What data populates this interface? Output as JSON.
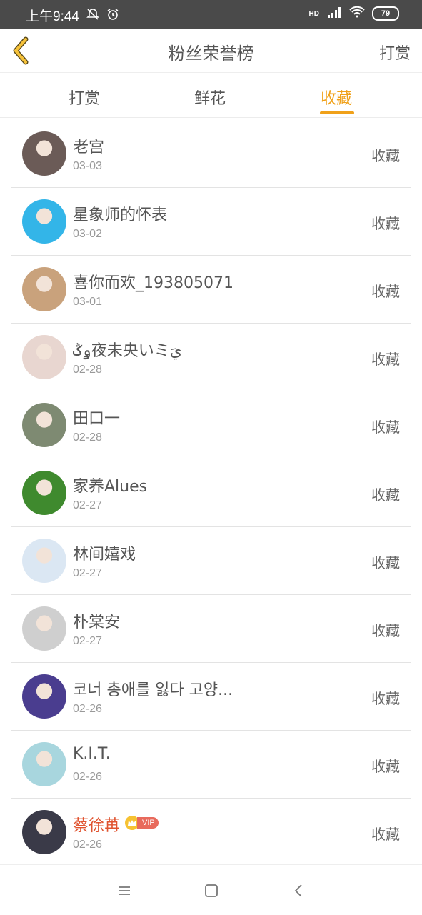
{
  "status_bar": {
    "time": "上午9:44",
    "battery": "79",
    "hd": "HD"
  },
  "header": {
    "title": "粉丝荣誉榜",
    "right_label": "打赏"
  },
  "tabs": [
    {
      "label": "打赏"
    },
    {
      "label": "鲜花"
    },
    {
      "label": "收藏"
    }
  ],
  "active_tab": "收藏",
  "list": [
    {
      "name": "老宫",
      "date": "03-03",
      "action": "收藏",
      "avatar_color": "#6b5b57"
    },
    {
      "name": "星象师的怀表",
      "date": "03-02",
      "action": "收藏",
      "avatar_color": "#33b5e8"
    },
    {
      "name": "喜你而欢_193805071",
      "date": "03-01",
      "action": "收藏",
      "avatar_color": "#c9a27c"
    },
    {
      "name": "ۅݣ夜未央いミيَ",
      "date": "02-28",
      "action": "收藏",
      "avatar_color": "#e8d6d0"
    },
    {
      "name": "田口一",
      "date": "02-28",
      "action": "收藏",
      "avatar_color": "#7e8a72"
    },
    {
      "name": "家养Alues",
      "date": "02-27",
      "action": "收藏",
      "avatar_color": "#3f8a2e"
    },
    {
      "name": "林间嬉戏",
      "date": "02-27",
      "action": "收藏",
      "avatar_color": "#dbe7f3"
    },
    {
      "name": "朴棠安",
      "date": "02-27",
      "action": "收藏",
      "avatar_color": "#cfcfcf"
    },
    {
      "name": "코너 총애를 잃다 고양...",
      "date": "02-26",
      "action": "收藏",
      "avatar_color": "#4a3d8f"
    },
    {
      "name": "K.I.T.",
      "date": "02-26",
      "action": "收藏",
      "avatar_color": "#a8d6de"
    },
    {
      "name": "蔡徐苒",
      "date": "02-26",
      "action": "收藏",
      "avatar_color": "#3a3a48",
      "vip": true,
      "vip_label": "VIP"
    }
  ],
  "colors": {
    "accent": "#f0a11a",
    "status_bar": "#4a4a4a",
    "vip_name": "#e0532f"
  }
}
